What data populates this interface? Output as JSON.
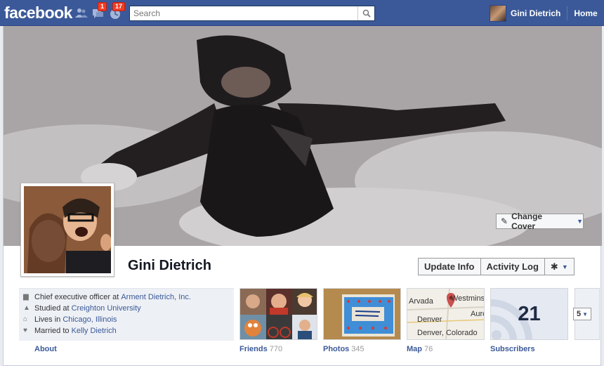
{
  "topbar": {
    "logo": "facebook",
    "badges": {
      "messages": "1",
      "notifications": "17"
    },
    "search": {
      "placeholder": "Search"
    },
    "user_name": "Gini Dietrich",
    "home_label": "Home"
  },
  "cover": {
    "change_cover_label": "Change Cover"
  },
  "profile": {
    "name": "Gini Dietrich",
    "update_info_label": "Update Info",
    "activity_log_label": "Activity Log"
  },
  "info": [
    {
      "icon": "work-icon",
      "text": "Chief executive officer at ",
      "link": "Arment Dietrich, Inc."
    },
    {
      "icon": "school-icon",
      "text": "Studied at ",
      "link": "Creighton University"
    },
    {
      "icon": "home-icon",
      "text": "Lives in ",
      "link": "Chicago, Illinois"
    },
    {
      "icon": "heart-icon",
      "text": "Married to ",
      "link": "Kelly Dietrich"
    }
  ],
  "about_label": "About",
  "tiles": {
    "friends": {
      "label": "Friends",
      "count": "770"
    },
    "photos": {
      "label": "Photos",
      "count": "345"
    },
    "map": {
      "label": "Map",
      "count": "76",
      "places": [
        "Arvada",
        "Westminste",
        "Denver",
        "Aurc",
        "Denver, Colorado"
      ]
    },
    "subscribers": {
      "label": "Subscribers",
      "count": "21"
    },
    "more": {
      "label": "5"
    }
  },
  "colors": {
    "brand": "#3b5998",
    "badge": "#f03d25"
  }
}
